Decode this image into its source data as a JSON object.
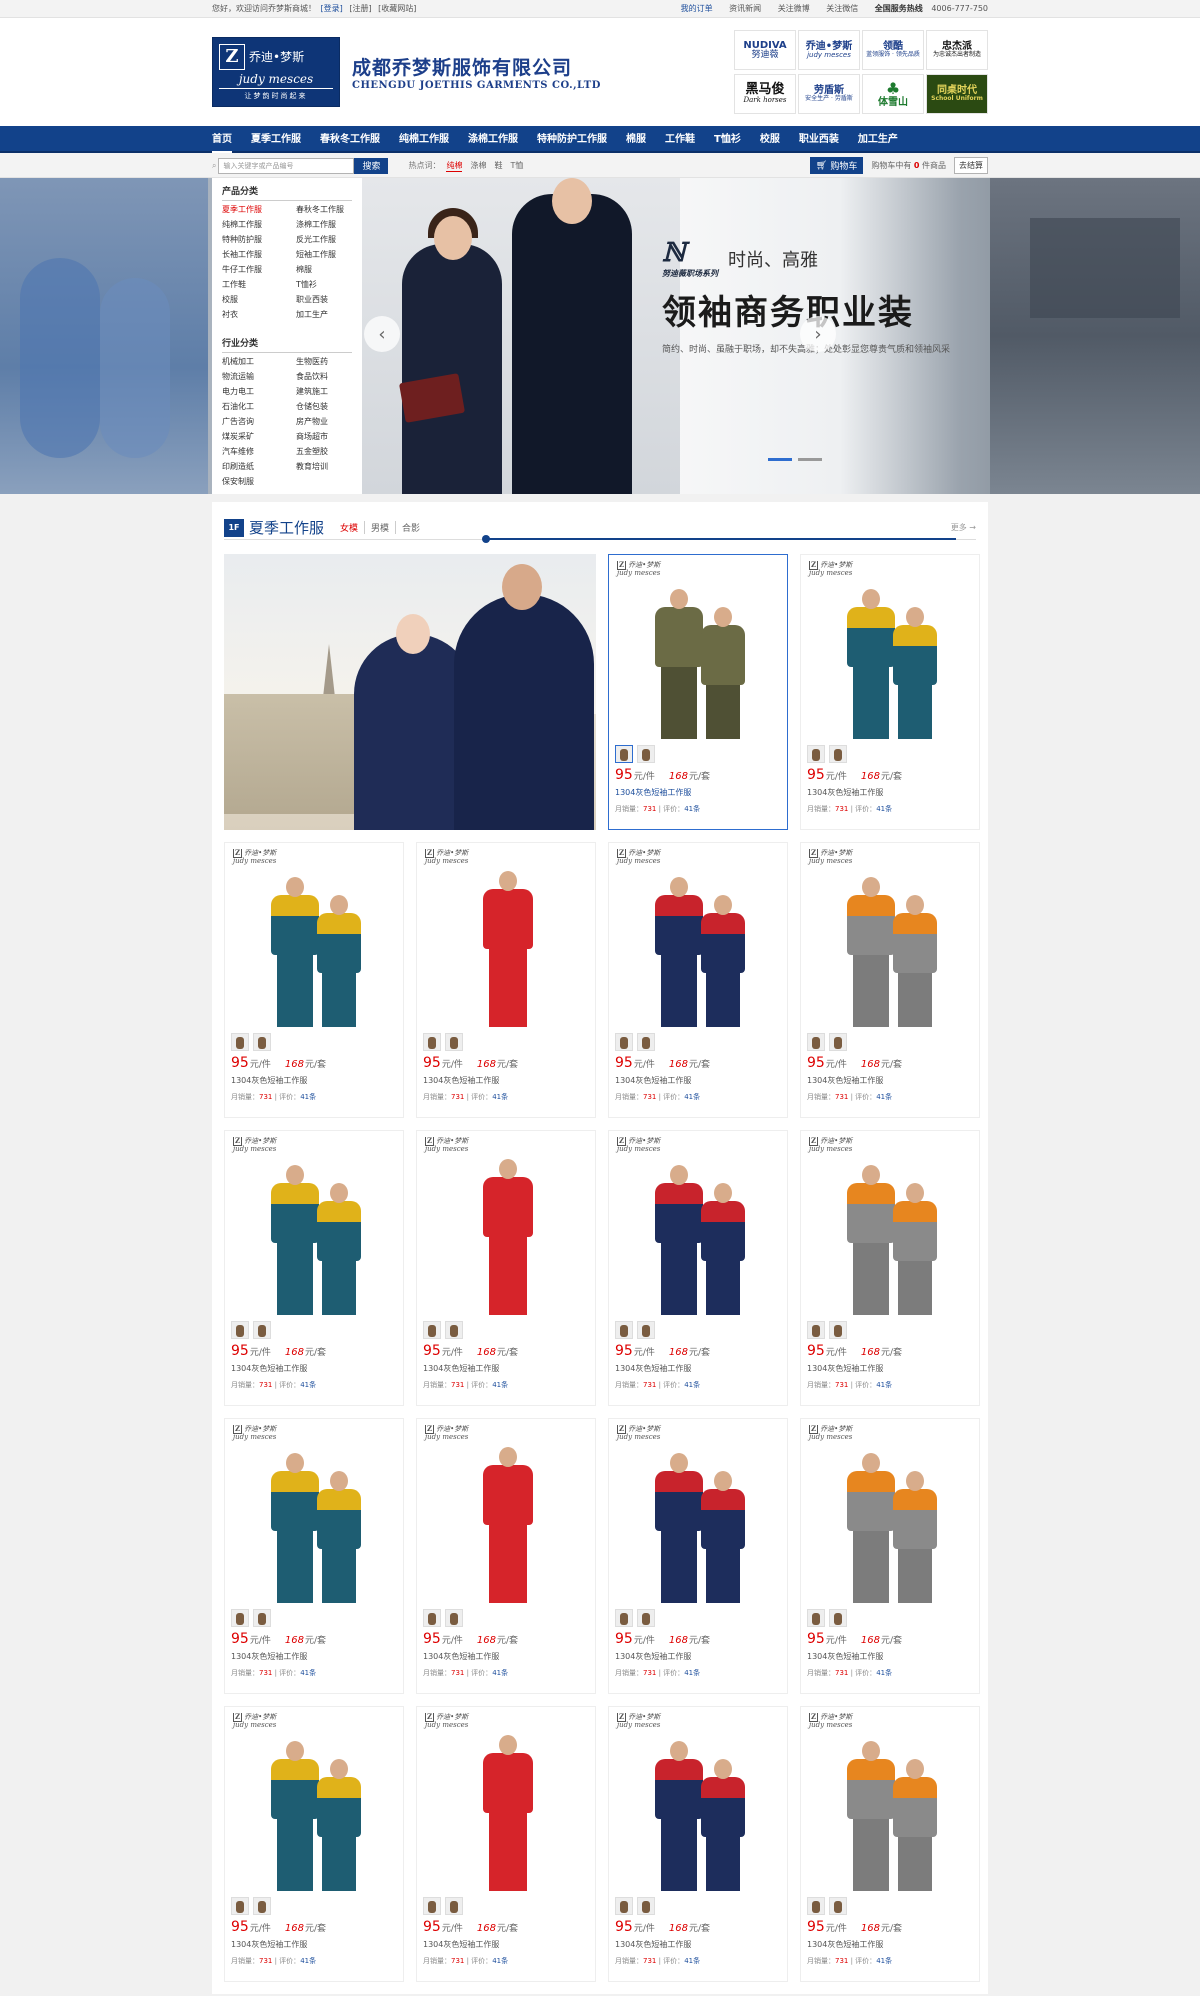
{
  "topbar": {
    "welcome": "您好，欢迎访问乔梦斯商城！",
    "login": "[登录]",
    "register": "[注册]",
    "favorite": "[收藏网站]",
    "my_orders": "我的订单",
    "news": "资讯新闻",
    "weibo": "关注微博",
    "weixin": "关注微信",
    "hotline_label": "全国服务热线",
    "hotline": "4006-777-750"
  },
  "header": {
    "logo_cn": "乔迪•梦斯",
    "logo_en": "judy mesces",
    "logo_slogan": "让梦韵时尚起来",
    "company_cn": "成都乔梦斯服饰有限公司",
    "company_en": "CHENGDU JOETHIS GARMENTS CO.,LTD",
    "brands": [
      {
        "name": "NUDIVA",
        "sub": "努迪薇"
      },
      {
        "name": "乔迪•梦斯",
        "sub": "judy mesces"
      },
      {
        "name": "领酷",
        "sub": "蓝领服饰 · 领先品质"
      },
      {
        "name": "忠杰派",
        "sub": "为忠诚杰出者制造"
      },
      {
        "name": "黑马俊",
        "sub": "Dark horses"
      },
      {
        "name": "劳盾斯",
        "sub": "安全生产 · 劳盾斯"
      },
      {
        "name": "体雪山",
        "sub": ""
      },
      {
        "name": "同桌时代",
        "sub": "School Uniform"
      }
    ]
  },
  "nav": {
    "items": [
      "首页",
      "夏季工作服",
      "春秋冬工作服",
      "纯棉工作服",
      "涤棉工作服",
      "特种防护工作服",
      "棉服",
      "工作鞋",
      "T恤衫",
      "校服",
      "职业西装",
      "加工生产"
    ]
  },
  "search": {
    "placeholder": "输入关键字或产品编号",
    "button": "搜索",
    "hot_label": "热点词：",
    "hot_words": [
      "纯棉",
      "涤棉",
      "鞋",
      "T恤"
    ],
    "cart_button": "购物车",
    "cart_text_pre": "购物车中有",
    "cart_count": "0",
    "cart_text_post": "件商品",
    "checkout": "去结算"
  },
  "categories": {
    "product_title": "产品分类",
    "product_items": [
      "夏季工作服",
      "春秋冬工作服",
      "纯棉工作服",
      "涤棉工作服",
      "特种防护服",
      "反光工作服",
      "长袖工作服",
      "短袖工作服",
      "牛仔工作服",
      "棉服",
      "工作鞋",
      "T恤衫",
      "校服",
      "职业西装",
      "衬衣",
      "加工生产"
    ],
    "industry_title": "行业分类",
    "industry_items": [
      "机械加工",
      "生物医药",
      "物流运输",
      "食品饮料",
      "电力电工",
      "建筑施工",
      "石油化工",
      "仓储包装",
      "广告咨询",
      "房产物业",
      "煤炭采矿",
      "商场超市",
      "汽车维修",
      "五金塑胶",
      "印刷造纸",
      "教育培训",
      "保安制服"
    ]
  },
  "banner": {
    "brand_text": "努迪薇职场系列",
    "sub": "时尚、高雅",
    "big": "领袖商务职业装",
    "desc": "简约、时尚、虽融于职场，却不失高雅；处处彰显您尊贵气质和领袖风采"
  },
  "section": {
    "floor": "1F",
    "title": "夏季工作服",
    "tabs": [
      "女模",
      "男模",
      "合影"
    ],
    "more": "更多 →"
  },
  "product_template": {
    "price1": "95",
    "unit1": "元/件",
    "price2": "168",
    "unit2": "元/套",
    "name": "1304灰色短袖工作服",
    "sales_label": "月销量：",
    "sales": "731",
    "review_label": "| 评价：",
    "reviews": "41条"
  },
  "colors": {
    "brand_blue": "#12428a",
    "price_red": "#dd0000"
  }
}
